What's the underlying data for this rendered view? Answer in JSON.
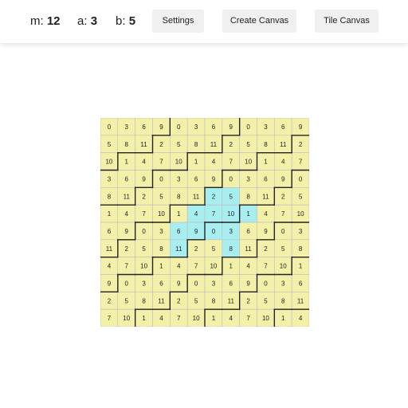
{
  "toolbar": {
    "m_label": "m:",
    "m_value": "12",
    "a_label": "a:",
    "a_value": "3",
    "b_label": "b:",
    "b_value": "5",
    "settings_label": "Settings",
    "create_label": "Create Canvas",
    "tile_label": "Tile Canvas"
  },
  "colors": {
    "cell_fill": "#f3f0a9",
    "highlight_fill": "#a8eef0",
    "grid_line": "#bdbdbd",
    "border_line": "#222222"
  },
  "grid": {
    "rows": 12,
    "cols": 12,
    "values": [
      [
        0,
        3,
        6,
        9,
        0,
        3,
        6,
        9,
        0,
        3,
        6,
        9
      ],
      [
        5,
        8,
        11,
        2,
        5,
        8,
        11,
        2,
        5,
        8,
        11,
        2
      ],
      [
        10,
        1,
        4,
        7,
        10,
        1,
        4,
        7,
        10,
        1,
        4,
        7
      ],
      [
        3,
        6,
        9,
        0,
        3,
        6,
        9,
        0,
        3,
        6,
        9,
        0
      ],
      [
        8,
        11,
        2,
        5,
        8,
        11,
        2,
        5,
        8,
        11,
        2,
        5
      ],
      [
        1,
        4,
        7,
        10,
        1,
        4,
        7,
        10,
        1,
        4,
        7,
        10
      ],
      [
        6,
        9,
        0,
        3,
        6,
        9,
        0,
        3,
        6,
        9,
        0,
        3
      ],
      [
        11,
        2,
        5,
        8,
        11,
        2,
        5,
        8,
        11,
        2,
        5,
        8
      ],
      [
        4,
        7,
        10,
        1,
        4,
        7,
        10,
        1,
        4,
        7,
        10,
        1
      ],
      [
        9,
        0,
        3,
        6,
        9,
        0,
        3,
        6,
        9,
        0,
        3,
        6
      ],
      [
        2,
        5,
        8,
        11,
        2,
        5,
        8,
        11,
        2,
        5,
        8,
        11
      ],
      [
        7,
        10,
        1,
        4,
        7,
        10,
        1,
        4,
        7,
        10,
        1,
        4
      ]
    ],
    "highlighted": [
      [
        4,
        6
      ],
      [
        4,
        7
      ],
      [
        5,
        5
      ],
      [
        5,
        6
      ],
      [
        5,
        7
      ],
      [
        5,
        8
      ],
      [
        6,
        4
      ],
      [
        6,
        5
      ],
      [
        6,
        6
      ],
      [
        6,
        7
      ],
      [
        7,
        4
      ],
      [
        7,
        7
      ]
    ]
  }
}
